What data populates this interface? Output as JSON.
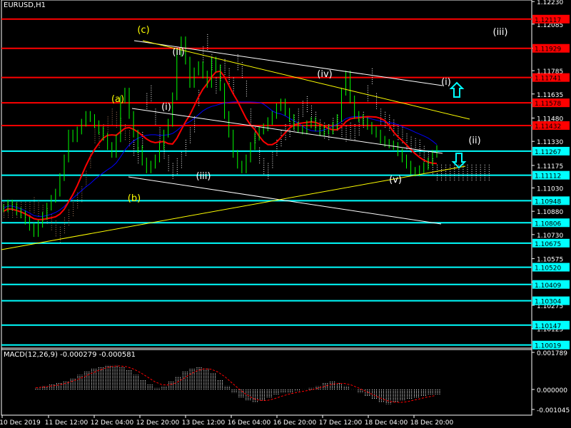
{
  "symbol_label": "EURUSD,H1",
  "macd_label": "MACD(12,26,9) -0.000279 -0.000581",
  "colors": {
    "background": "#000000",
    "price": "#00ff00",
    "axis": "#ffffff",
    "red_level": "#ff0000",
    "cyan_level": "#00ffff",
    "red_label_bg": "#ff0000",
    "cyan_label_bg": "#00ffff",
    "cloud": "#ffffff",
    "cloud_dim": "#b08060",
    "ma_red": "#ff0000",
    "ma_blue": "#0000ff",
    "wave_white": "#ffffff",
    "wave_yellow": "#ffff00",
    "arrow": "#00ffff"
  },
  "chart_data": {
    "type": "line",
    "series_name": "EURUSD H1",
    "ylim": [
      1.0999,
      1.1224
    ],
    "y_ticks": [
      "1.12230",
      "1.12085",
      "1.11930",
      "1.11785",
      "1.11635",
      "1.11480",
      "1.11330",
      "1.11175",
      "1.11030",
      "1.10880",
      "1.10730",
      "1.10575",
      "1.10425",
      "1.10275",
      "1.10125"
    ],
    "x_ticks": [
      "10 Dec 2019",
      "11 Dec 12:00",
      "12 Dec 04:00",
      "12 Dec 20:00",
      "13 Dec 12:00",
      "16 Dec 04:00",
      "16 Dec 20:00",
      "17 Dec 12:00",
      "18 Dec 04:00",
      "18 Dec 20:00"
    ],
    "red_levels": [
      {
        "value": 1.12117,
        "label": "1.12117"
      },
      {
        "value": 1.11929,
        "label": "1.11929"
      },
      {
        "value": 1.11741,
        "label": "1.11741"
      },
      {
        "value": 1.11578,
        "label": "1.11578"
      },
      {
        "value": 1.11432,
        "label": "1.11432"
      }
    ],
    "cyan_levels": [
      {
        "value": 1.11267,
        "label": "1.11267"
      },
      {
        "value": 1.11112,
        "label": "1.11112"
      },
      {
        "value": 1.10948,
        "label": "1.10948"
      },
      {
        "value": 1.10806,
        "label": "1.10806"
      },
      {
        "value": 1.10675,
        "label": "1.10675"
      },
      {
        "value": 1.1052,
        "label": "1.10520"
      },
      {
        "value": 1.10409,
        "label": "1.10409"
      },
      {
        "value": 1.10304,
        "label": "1.10304"
      },
      {
        "value": 1.10147,
        "label": "1.10147"
      },
      {
        "value": 1.10019,
        "label": "1.10019"
      }
    ],
    "price": [
      1.109,
      1.1093,
      1.1091,
      1.1088,
      1.1086,
      1.1082,
      1.1078,
      1.1074,
      1.108,
      1.1085,
      1.1091,
      1.1096,
      1.11,
      1.111,
      1.1122,
      1.1138,
      1.1135,
      1.114,
      1.1145,
      1.115,
      1.1148,
      1.1144,
      1.114,
      1.1136,
      1.113,
      1.1125,
      1.1135,
      1.116,
      1.1165,
      1.115,
      1.1138,
      1.1128,
      1.112,
      1.1115,
      1.1118,
      1.1122,
      1.113,
      1.1138,
      1.1145,
      1.1162,
      1.119,
      1.1198,
      1.1185,
      1.117,
      1.1178,
      1.1182,
      1.1176,
      1.117,
      1.1185,
      1.118,
      1.1168,
      1.115,
      1.1138,
      1.1125,
      1.1118,
      1.1115,
      1.1122,
      1.113,
      1.1136,
      1.114,
      1.1142,
      1.1146,
      1.115,
      1.1155,
      1.1158,
      1.1152,
      1.1148,
      1.1143,
      1.1141,
      1.114,
      1.1144,
      1.1146,
      1.1142,
      1.1139,
      1.1141,
      1.114,
      1.1143,
      1.1148,
      1.1165,
      1.1176,
      1.116,
      1.115,
      1.1148,
      1.1146,
      1.1143,
      1.114,
      1.1138,
      1.1134,
      1.1132,
      1.1131,
      1.113,
      1.1126,
      1.1122,
      1.1118,
      1.1114,
      1.1113,
      1.1115,
      1.1117,
      1.112,
      1.1125,
      1.1128
    ],
    "macd_hist": [
      0.0001,
      0.0002,
      0.0003,
      0.0004,
      0.0005,
      0.0007,
      0.0009,
      0.0011,
      0.0013,
      0.0014,
      0.0015,
      0.0015,
      0.0014,
      0.0012,
      0.0009,
      0.0006,
      0.0003,
      0.0001,
      0.0002,
      0.0005,
      0.0008,
      0.0011,
      0.0013,
      0.0014,
      0.0013,
      0.001,
      0.0006,
      0.0002,
      -0.0002,
      -0.0005,
      -0.0007,
      -0.0008,
      -0.0007,
      -0.0005,
      -0.0003,
      -0.0002,
      -0.0002,
      -0.0001,
      0.0,
      0.0001,
      0.0002,
      0.0004,
      0.0005,
      0.0004,
      0.0002,
      0.0,
      -0.0002,
      -0.0004,
      -0.0006,
      -0.0008,
      -0.0009,
      -0.0008,
      -0.0007,
      -0.0006,
      -0.0005,
      -0.0004,
      -0.0003,
      -0.0003
    ],
    "macd_ticks": [
      "0.001789",
      "0.000000",
      "-0.001045"
    ],
    "annotations": [
      {
        "text": "(c)",
        "color": "#ffff00"
      },
      {
        "text": "(ii)",
        "color": "#ffffff"
      },
      {
        "text": "(a)",
        "color": "#ffff00"
      },
      {
        "text": "(i)",
        "color": "#ffffff"
      },
      {
        "text": "(iii)",
        "color": "#ffffff"
      },
      {
        "text": "(b)",
        "color": "#ffff00"
      },
      {
        "text": "(iv)",
        "color": "#ffffff"
      },
      {
        "text": "(v)",
        "color": "#ffffff"
      },
      {
        "text": "(i)",
        "color": "#ffffff"
      },
      {
        "text": "(ii)",
        "color": "#ffffff"
      },
      {
        "text": "(iii)",
        "color": "#ffffff"
      }
    ]
  }
}
